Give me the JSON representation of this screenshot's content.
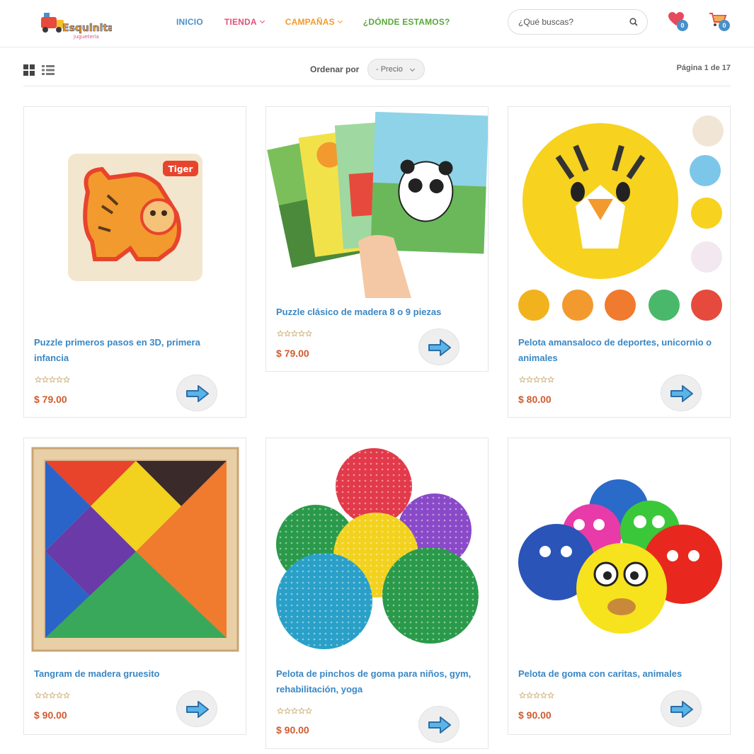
{
  "header": {
    "logo_text": "Esquinitas",
    "logo_subtext": "juguetería",
    "nav": [
      {
        "label": "INICIO",
        "color": "#4a90c8",
        "has_dropdown": false
      },
      {
        "label": "TIENDA",
        "color": "#e0507a",
        "has_dropdown": true
      },
      {
        "label": "CAMPAÑAS",
        "color": "#f29a2e",
        "has_dropdown": true
      },
      {
        "label": "¿DÓNDE ESTAMOS?",
        "color": "#5aa83a",
        "has_dropdown": false
      }
    ],
    "search": {
      "placeholder": "¿Qué buscas?",
      "value": "",
      "icon": "search-icon"
    },
    "wishlist": {
      "icon": "heart-icon",
      "count": "0"
    },
    "cart": {
      "icon": "shopping-cart-icon",
      "count": "0"
    }
  },
  "toolbar": {
    "grid_view_icon": "grid-view-icon",
    "list_view_icon": "list-view-icon",
    "sort_label": "Ordenar por",
    "sort_selected": "- Precio",
    "page_info": "Página 1 de 17"
  },
  "products": [
    {
      "title": "Puzzle primeros pasos en 3D, primera infancia",
      "rating": 0,
      "price": "$ 79.00",
      "image": "wooden tiger puzzle"
    },
    {
      "title": "Puzzle clásico de madera 8 o 9 piezas",
      "rating": 0,
      "price": "$ 79.00",
      "image": "wooden jigsaw puzzles with panda"
    },
    {
      "title": "Pelota amansaloco de deportes, unicornio o animales",
      "rating": 0,
      "price": "$ 80.00",
      "image": "yellow tiger foam ball with animal variants"
    },
    {
      "title": "Tangram de madera gruesito",
      "rating": 0,
      "price": "$ 90.00",
      "image": "wooden colored tangram"
    },
    {
      "title": "Pelota de pinchos de goma para niños, gym, rehabilitación, yoga",
      "rating": 0,
      "price": "$ 90.00",
      "image": "spiky rubber balls"
    },
    {
      "title": "Pelota de goma con caritas, animales",
      "rating": 0,
      "price": "$ 90.00",
      "image": "rubber balls with animal faces"
    }
  ],
  "colors": {
    "link": "#3a87c4",
    "price": "#d15b2e",
    "accent_blue": "#4a90c8"
  }
}
